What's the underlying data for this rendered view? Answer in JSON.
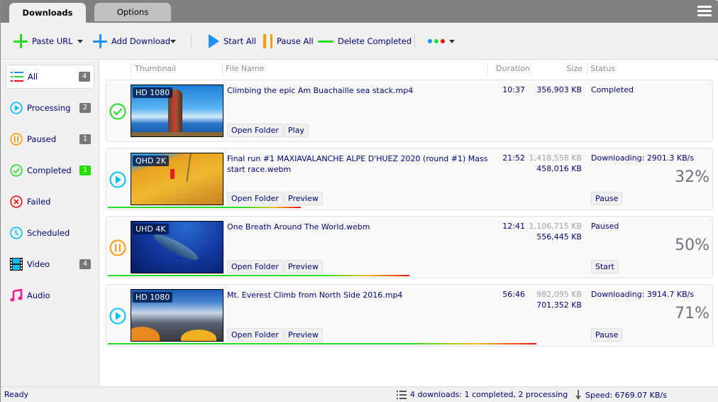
{
  "tabs": [
    {
      "label": "Downloads",
      "active": true
    },
    {
      "label": "Options",
      "active": false
    }
  ],
  "toolbar": {
    "paste_url": "Paste URL",
    "add_download": "Add Download",
    "start_all": "Start All",
    "pause_all": "Pause All",
    "delete_completed": "Delete Completed"
  },
  "colors": {
    "green": "#22dd22",
    "blue": "#1e90ff",
    "cyan": "#00bfff",
    "orange": "#ff9900",
    "red": "#ee1111",
    "magenta": "#ff1493"
  },
  "sidebar": {
    "items": [
      {
        "label": "All",
        "count": "4",
        "icon": "list-icon"
      },
      {
        "label": "Processing",
        "count": "2",
        "icon": "play-circle-icon"
      },
      {
        "label": "Paused",
        "count": "1",
        "icon": "pause-circle-icon"
      },
      {
        "label": "Completed",
        "count": "1",
        "icon": "check-circle-icon"
      },
      {
        "label": "Failed",
        "count": "",
        "icon": "x-circle-icon"
      },
      {
        "label": "Scheduled",
        "count": "",
        "icon": "clock-icon"
      },
      {
        "label": "Video",
        "count": "4",
        "icon": "film-icon"
      },
      {
        "label": "Audio",
        "count": "",
        "icon": "music-note-icon"
      }
    ]
  },
  "columns": {
    "thumbnail": "Thumbnail",
    "file_name": "File Name",
    "duration": "Duration",
    "size": "Size",
    "status": "Status"
  },
  "downloads": [
    {
      "state": "completed",
      "quality": "HD 1080",
      "file_name": "Climbing the epic Am Buachaille sea stack.mp4",
      "duration": "10:37",
      "size_total": "",
      "size_done": "356,903 KB",
      "status": "Completed",
      "percent": "",
      "progress": 1.0,
      "buttons": [
        "Open Folder",
        "Play"
      ],
      "action": ""
    },
    {
      "state": "processing",
      "quality": "QHD 2K",
      "file_name": "Final run #1  MAXIAVALANCHE ALPE D'HUEZ 2020 (round #1) Mass start race.webm",
      "duration": "21:52",
      "size_total": "1,418,558 KB",
      "size_done": "458,016 KB",
      "status": "Downloading: 2901.3 KB/s",
      "percent": "32%",
      "progress": 0.32,
      "buttons": [
        "Open Folder",
        "Preview"
      ],
      "action": "Pause"
    },
    {
      "state": "paused",
      "quality": "UHD 4K",
      "file_name": "One Breath Around The World.webm",
      "duration": "12:41",
      "size_total": "1,106,715 KB",
      "size_done": "556,445 KB",
      "status": "Paused",
      "percent": "50%",
      "progress": 0.5,
      "buttons": [
        "Open Folder",
        "Preview"
      ],
      "action": "Start"
    },
    {
      "state": "processing",
      "quality": "HD 1080",
      "file_name": "Mt. Everest Climb from North Side 2016.mp4",
      "duration": "56:46",
      "size_total": "982,095 KB",
      "size_done": "701,352 KB",
      "status": "Downloading: 3914.7 KB/s",
      "percent": "71%",
      "progress": 0.71,
      "buttons": [
        "Open Folder",
        "Preview"
      ],
      "action": "Pause"
    }
  ],
  "statusbar": {
    "ready": "Ready",
    "summary": "4 downloads: 1 completed, 2 processing",
    "speed": "Speed: 6769.07 KB/s"
  }
}
